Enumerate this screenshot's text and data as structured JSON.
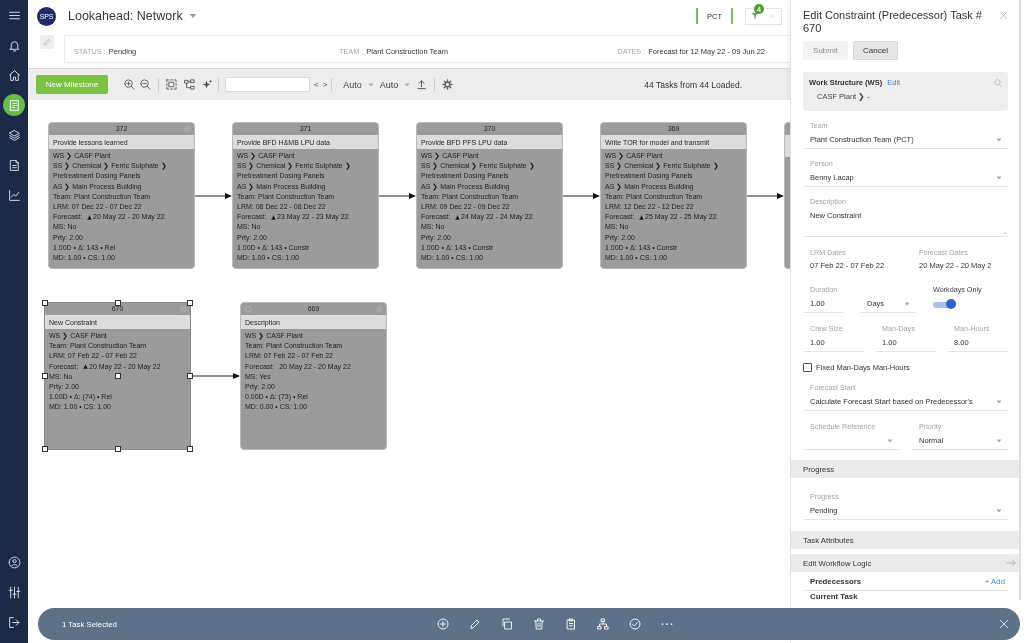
{
  "sidebar": {
    "items": [
      {
        "selected": false
      },
      {
        "selected": false
      },
      {
        "selected": true
      },
      {
        "selected": false
      },
      {
        "selected": false
      },
      {
        "selected": false
      }
    ]
  },
  "header": {
    "logo": "SPS",
    "title": "Lookahead: Network",
    "team_filter": "PCT",
    "filter_count": "4"
  },
  "info": [
    {
      "label": "STATUS :",
      "value": "Pending"
    },
    {
      "label": "TEAM :",
      "value": "Plant Construction Team"
    },
    {
      "label": "DATES :",
      "value": "Forecast for 12 May 22 - 09 Jun 22"
    }
  ],
  "toolbar": {
    "new_button": "New Milestone",
    "prev": "<",
    "next": ">",
    "dropdowns": [
      "Auto",
      "Auto"
    ],
    "summary": "44 Tasks from 44 Loaded."
  },
  "network": {
    "rows": [
      [
        {
          "kind": "task",
          "id": "372",
          "title": "Provide lessons learned",
          "closable": true,
          "start_marker": false,
          "selected": false,
          "arrow_out": true,
          "lines": [
            {
              "kind": "text",
              "text": "WS ❯ CASF Plant"
            },
            {
              "kind": "text",
              "text": "SS ❯ Chemical ❯ Ferric Sulphate ❯ Pretreatment Dosing Panels"
            },
            {
              "kind": "text",
              "text": "AS ❯ Main Process Building"
            },
            {
              "kind": "text",
              "text": "Team: Plant Construction Team"
            },
            {
              "kind": "text",
              "text": "LRM: 07 Dec 22 - 07 Dec 22"
            },
            {
              "kind": "forecast",
              "label": "Forecast:",
              "value": "20 May 22 - 20 May 22",
              "flagged": true
            },
            {
              "kind": "text",
              "text": "MS: No"
            },
            {
              "kind": "text",
              "text": "Prty: 2.00"
            },
            {
              "kind": "text",
              "text": "1.00D • Δ: 143 • Rel"
            },
            {
              "kind": "text",
              "text": "MD: 1.00 • CS: 1.00"
            }
          ]
        },
        {
          "kind": "task",
          "id": "371",
          "title": "Provide BFD H&MB LPU data",
          "closable": false,
          "start_marker": false,
          "selected": false,
          "arrow_out": true,
          "lines": [
            {
              "kind": "text",
              "text": "WS ❯ CASF Plant"
            },
            {
              "kind": "text",
              "text": "SS ❯ Chemical ❯ Ferric Sulphate ❯ Pretreatment Dosing Panels"
            },
            {
              "kind": "text",
              "text": "AS ❯ Main Process Building"
            },
            {
              "kind": "text",
              "text": "Team: Plant Construction Team"
            },
            {
              "kind": "text",
              "text": "LRM: 08 Dec 22 - 08 Dec 22"
            },
            {
              "kind": "forecast",
              "label": "Forecast:",
              "value": "23 May 22 - 23 May 22",
              "flagged": true
            },
            {
              "kind": "text",
              "text": "MS: No"
            },
            {
              "kind": "text",
              "text": "Prty: 2.00"
            },
            {
              "kind": "text",
              "text": "1.00D • Δ: 143 • Constr"
            },
            {
              "kind": "text",
              "text": "MD: 1.00 • CS: 1.00"
            }
          ]
        },
        {
          "kind": "task",
          "id": "370",
          "title": "Provide BFD PFS LPU data",
          "closable": false,
          "start_marker": false,
          "selected": false,
          "arrow_out": true,
          "lines": [
            {
              "kind": "text",
              "text": "WS ❯ CASF Plant"
            },
            {
              "kind": "text",
              "text": "SS ❯ Chemical ❯ Ferric Sulphate ❯ Pretreatment Dosing Panels"
            },
            {
              "kind": "text",
              "text": "AS ❯ Main Process Building"
            },
            {
              "kind": "text",
              "text": "Team: Plant Construction Team"
            },
            {
              "kind": "text",
              "text": "LRM: 09 Dec 22 - 09 Dec 22"
            },
            {
              "kind": "forecast",
              "label": "Forecast:",
              "value": "24 May 22 - 24 May 22",
              "flagged": true
            },
            {
              "kind": "text",
              "text": "MS: No"
            },
            {
              "kind": "text",
              "text": "Prty: 2.00"
            },
            {
              "kind": "text",
              "text": "1.00D • Δ: 143 • Constr"
            },
            {
              "kind": "text",
              "text": "MD: 1.00 • CS: 1.00"
            }
          ]
        },
        {
          "kind": "task",
          "id": "369",
          "title": "Write TOR for model and transmit",
          "closable": false,
          "start_marker": false,
          "selected": false,
          "arrow_out": true,
          "lines": [
            {
              "kind": "text",
              "text": "WS ❯ CASF Plant"
            },
            {
              "kind": "text",
              "text": "SS ❯ Chemical ❯ Ferric Sulphate ❯ Pretreatment Dosing Panels"
            },
            {
              "kind": "text",
              "text": "AS ❯ Main Process Building"
            },
            {
              "kind": "text",
              "text": "Team: Plant Construction Team"
            },
            {
              "kind": "text",
              "text": "LRM: 12 Dec 22 - 12 Dec 22"
            },
            {
              "kind": "forecast",
              "label": "Forecast:",
              "value": "25 May 22 - 25 May 22",
              "flagged": true
            },
            {
              "kind": "text",
              "text": "MS: No"
            },
            {
              "kind": "text",
              "text": "Prty: 2.00"
            },
            {
              "kind": "text",
              "text": "1.00D • Δ: 143 • Constr"
            },
            {
              "kind": "text",
              "text": "MD: 1.00 • CS: 1.00"
            }
          ]
        },
        {
          "kind": "clipped",
          "selected": false,
          "arrow_out": false
        }
      ],
      [
        {
          "kind": "task",
          "id": "670",
          "title": "New Constraint",
          "closable": true,
          "start_marker": false,
          "selected": true,
          "arrow_out": true,
          "lines": [
            {
              "kind": "text",
              "text": "WS ❯ CASF Plant"
            },
            {
              "kind": "text",
              "text": "Team: Plant Construction Team"
            },
            {
              "kind": "text",
              "text": "LRM: 07 Feb 22 - 07 Feb 22"
            },
            {
              "kind": "forecast",
              "label": "Forecast:",
              "value": "20 May 22 - 20 May 22",
              "flagged": true
            },
            {
              "kind": "text",
              "text": "MS: No"
            },
            {
              "kind": "text",
              "text": "Prty: 2.00"
            },
            {
              "kind": "text",
              "text": "1.00D • Δ: (74) • Rel"
            },
            {
              "kind": "text",
              "text": "MD: 1.00 • CS: 1.00"
            }
          ]
        },
        {
          "kind": "task",
          "id": "669",
          "title": "Description",
          "closable": true,
          "start_marker": true,
          "selected": false,
          "arrow_out": false,
          "lines": [
            {
              "kind": "text",
              "text": "WS ❯ CASF Plant"
            },
            {
              "kind": "text",
              "text": "Team: Plant Construction Team"
            },
            {
              "kind": "text",
              "text": "LRM: 07 Feb 22 - 07 Feb 22"
            },
            {
              "kind": "forecast",
              "label": "Forecast:",
              "value": "20 May 22 - 20 May 22",
              "flagged": false
            },
            {
              "kind": "text",
              "text": "MS: Yes"
            },
            {
              "kind": "text",
              "text": "Prty: 2.00"
            },
            {
              "kind": "text",
              "text": "0.00D • Δ: (73) • Rel"
            },
            {
              "kind": "text",
              "text": "MD: 0.00 • CS: 1.00"
            }
          ]
        }
      ]
    ]
  },
  "panel": {
    "title": "Edit Constraint (Predecessor) Task # 670",
    "buttons": [
      {
        "label": "Submit",
        "disabled": true
      },
      {
        "label": "Cancel",
        "disabled": false
      }
    ],
    "work_structure": {
      "title": "Work Structure (WS)",
      "link": "Edit",
      "path": "CASF Plant ❯ -"
    },
    "team": {
      "label": "Team",
      "value": "Plant Construction Team (PCT)"
    },
    "person": {
      "label": "Person",
      "value": "Benny Lacap"
    },
    "description": {
      "label": "Description",
      "value": "New Constraint"
    },
    "lrm_dates": {
      "label": "LRM Dates",
      "value": "07 Feb 22 - 07 Feb 22"
    },
    "forecast_dates": {
      "label": "Forecast Dates",
      "value": "20 May 22 - 20 May 2"
    },
    "duration": {
      "label": "Duration",
      "value": "1.00",
      "unit": "Days"
    },
    "workdays_only": {
      "label": "Workdays Only",
      "on": true
    },
    "effort": [
      {
        "label": "Crew Size",
        "value": "1.00"
      },
      {
        "label": "Man-Days",
        "value": "1.00"
      },
      {
        "label": "Man-Hours",
        "value": "8.00"
      }
    ],
    "fixed_effort": {
      "label": "Fixed Man-Days Man-Hours",
      "checked": false
    },
    "forecast_start": {
      "label": "Forecast Start",
      "value": "Calculate Forecast Start based on Predecessor's"
    },
    "schedule_reference": {
      "label": "Schedule Reference"
    },
    "priority": {
      "label": "Priority",
      "value": "Normal"
    },
    "progress": {
      "title": "Progress",
      "label": "Progress",
      "value": "Pending"
    },
    "task_attributes": {
      "title": "Task Attributes"
    },
    "workflow": {
      "title": "Edit Workflow Logic",
      "predecessors": "Predecessors",
      "add": "+ Add",
      "current_task": "Current Task"
    }
  },
  "selection_bar": {
    "text": "1 Task Selected"
  }
}
